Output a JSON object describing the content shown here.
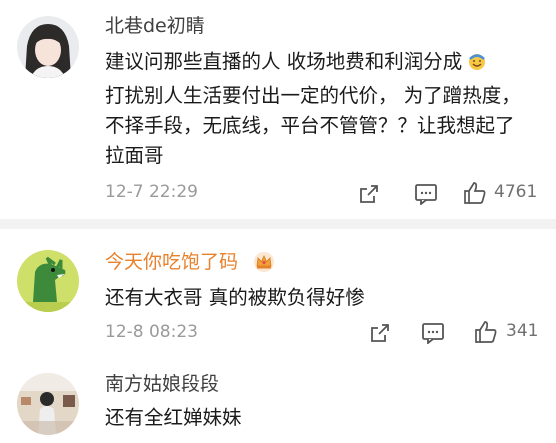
{
  "comments": [
    {
      "username": "北巷de初睛",
      "text": "建议问那些直播的人 收场地费和利润分成",
      "text_cont": "打扰别人生活要付出一定的代价， 为了蹭热度，不择手段，无底线，平台不管管？？让我想起了拉面哥",
      "emoji": "sweat-smile-emoji",
      "time": "12-7 22:29",
      "likes": "4761"
    },
    {
      "username": "今天你吃饱了码",
      "badge": "crown-icon",
      "text": "还有大衣哥 真的被欺负得好惨",
      "time": "12-8 08:23",
      "likes": "341"
    },
    {
      "username": "南方姑娘段段",
      "text": "还有全红婵妹妹"
    }
  ],
  "colors": {
    "vip_name": "#e8812c",
    "name": "#3f3f3f",
    "meta": "#9a9a9a",
    "icon": "#555555",
    "separator": "#f2f2f2"
  }
}
